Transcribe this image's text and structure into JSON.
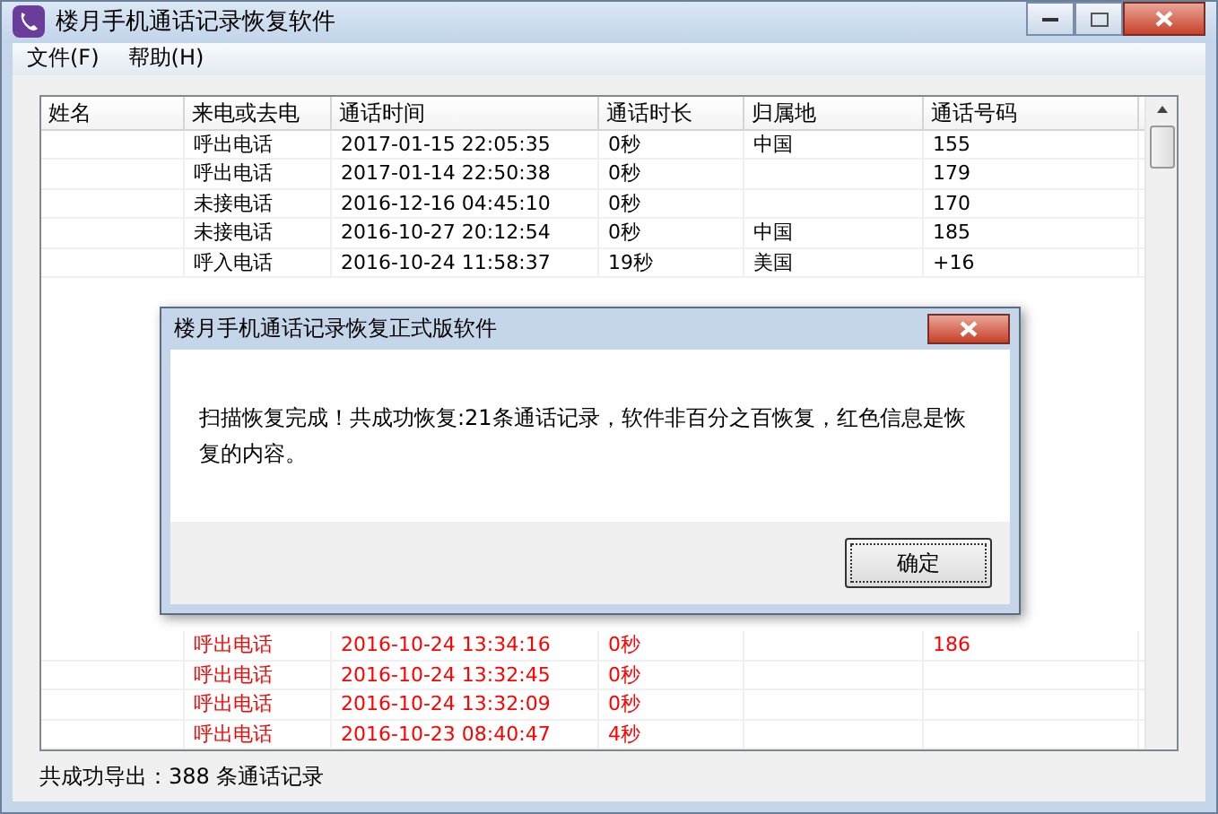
{
  "window": {
    "title": "楼月手机通话记录恢复软件"
  },
  "menu": [
    "文件(F)",
    "帮助(H)"
  ],
  "table": {
    "columns": [
      "姓名",
      "来电或去电",
      "通话时间",
      "通话时长",
      "归属地",
      "通话号码"
    ],
    "top_rows": [
      {
        "cells": [
          "",
          "呼出电话",
          "2017-01-15 22:05:35",
          "0秒",
          "中国",
          "155"
        ],
        "recovered": false
      },
      {
        "cells": [
          "",
          "呼出电话",
          "2017-01-14 22:50:38",
          "0秒",
          "",
          "179"
        ],
        "recovered": false
      },
      {
        "cells": [
          "",
          "未接电话",
          "2016-12-16 04:45:10",
          "0秒",
          "",
          "170"
        ],
        "recovered": false
      },
      {
        "cells": [
          "",
          "未接电话",
          "2016-10-27 20:12:54",
          "0秒",
          "中国",
          "185"
        ],
        "recovered": false
      },
      {
        "cells": [
          "",
          "呼入电话",
          "2016-10-24 11:58:37",
          "19秒",
          "美国",
          "+16"
        ],
        "recovered": false
      }
    ],
    "bottom_rows": [
      {
        "cells": [
          "",
          "呼出电话",
          "2016-10-24 13:34:16",
          "0秒",
          "",
          "186"
        ],
        "recovered": true
      },
      {
        "cells": [
          "",
          "呼出电话",
          "2016-10-24 13:32:45",
          "0秒",
          "",
          ""
        ],
        "recovered": true
      },
      {
        "cells": [
          "",
          "呼出电话",
          "2016-10-24 13:32:09",
          "0秒",
          "",
          ""
        ],
        "recovered": true
      },
      {
        "cells": [
          "",
          "呼出电话",
          "2016-10-23 08:40:47",
          "4秒",
          "",
          ""
        ],
        "recovered": true
      }
    ]
  },
  "status_bar": "共成功导出：388 条通话记录",
  "dialog": {
    "title": "楼月手机通话记录恢复正式版软件",
    "message": "扫描恢复完成！共成功恢复:21条通话记录，软件非百分之百恢复，红色信息是恢复的内容。",
    "button": "确定"
  }
}
